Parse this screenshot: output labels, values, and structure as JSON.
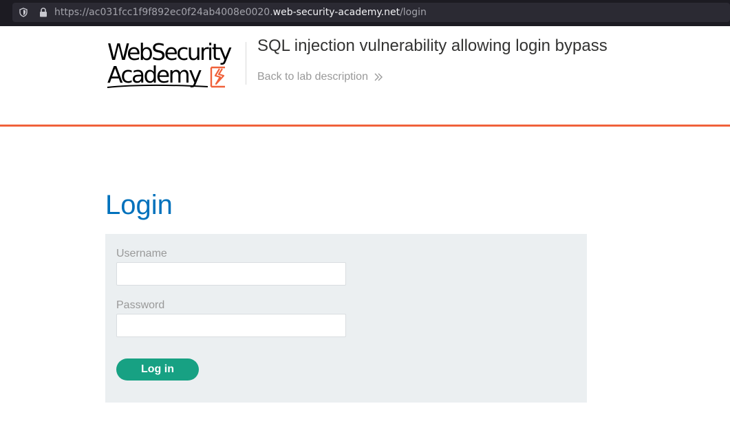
{
  "browser": {
    "url_prefix": "https://ac031fcc1f9f892ec0f24ab4008e0020.",
    "url_host": "web-security-academy.net",
    "url_path": "/login",
    "icons": [
      "shield-icon",
      "lock-icon"
    ]
  },
  "header": {
    "logo_line1": "WebSecurity",
    "logo_line2": "Academy",
    "lab_title": "SQL injection vulnerability allowing login bypass",
    "back_link": "Back to lab description",
    "back_link_icon": "double-chevron-right-icon",
    "accent_color": "#f0613a"
  },
  "main": {
    "heading": "Login",
    "heading_color": "#0071bc",
    "form": {
      "username_label": "Username",
      "username_value": "",
      "password_label": "Password",
      "password_value": "",
      "submit_label": "Log in",
      "submit_color": "#17a183"
    }
  }
}
